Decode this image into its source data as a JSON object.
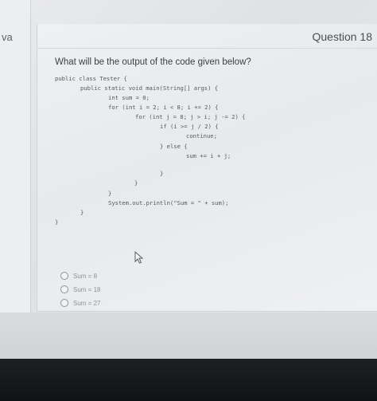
{
  "sidebar": {
    "label": "va"
  },
  "question": {
    "number": "Question 18",
    "text": "What will be the output of the code given below?"
  },
  "code_lines": [
    "public class Tester {",
    "public static void main(String[] args) {",
    "int sum = 0;",
    "for (int i = 2; i < 8; i += 2) {",
    "for (int j = 8; j > i; j -= 2) {",
    "if (i >= j / 2) {",
    "continue;",
    "} else {",
    "sum += i + j;",
    "}",
    "}",
    "}",
    "System.out.println(\"Sum = \" + sum);",
    "}",
    "}"
  ],
  "options": [
    "Sum = 8",
    "Sum = 18",
    "Sum = 27"
  ]
}
